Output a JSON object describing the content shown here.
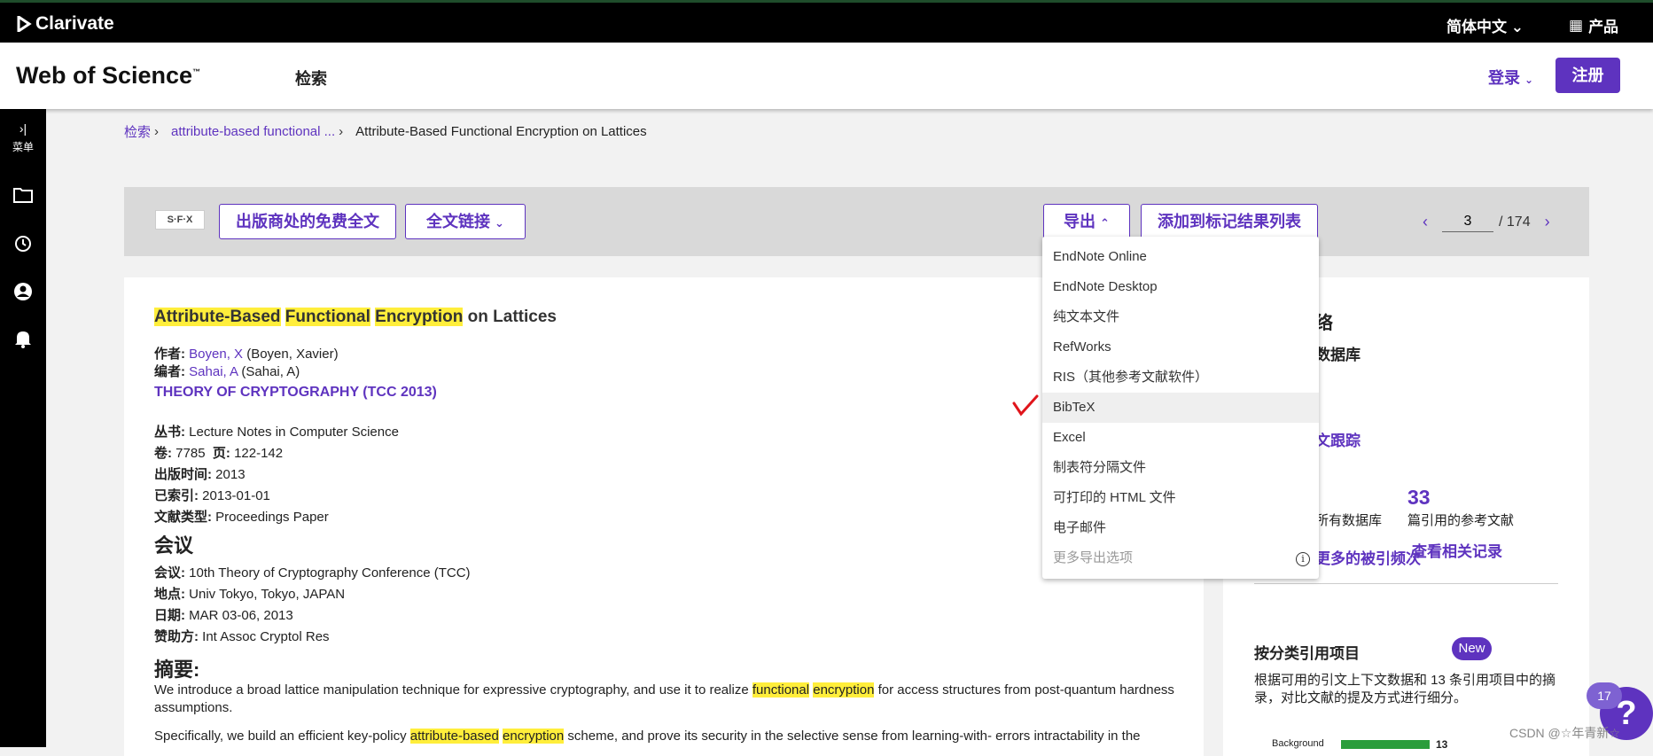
{
  "topbar": {
    "brand": "Clarivate",
    "language": "简体中文",
    "products": "产品"
  },
  "header": {
    "product": "Web of Science",
    "tm": "™",
    "search": "检索",
    "login": "登录",
    "register": "注册"
  },
  "sidebar": {
    "menu_label": "菜单"
  },
  "breadcrumb": {
    "root": "检索",
    "query": "attribute-based functional ...",
    "current": "Attribute-Based Functional Encryption on Lattices"
  },
  "toolbar": {
    "sfx": "S·F·X",
    "free_fulltext": "出版商处的免费全文",
    "fulltext_links": "全文链接",
    "export": "导出",
    "add_to_marked": "添加到标记结果列表",
    "page_current": "3",
    "page_total": "/ 174"
  },
  "export_menu": {
    "options": [
      "EndNote Online",
      "EndNote Desktop",
      "纯文本文件",
      "RefWorks",
      "RIS（其他参考文献软件）",
      "BibTeX",
      "Excel",
      "制表符分隔文件",
      "可打印的 HTML 文件",
      "电子邮件",
      "更多导出选项"
    ],
    "selected": "BibTeX"
  },
  "record": {
    "title_parts": [
      "Attribute-Based",
      "Functional",
      "Encryption",
      "on Lattices"
    ],
    "author_label": "作者:",
    "author_link": "Boyen, X",
    "author_full": "(Boyen, Xavier)",
    "editor_label": "编者:",
    "editor_link": "Sahai, A",
    "editor_full": "(Sahai, A)",
    "source": "THEORY OF CRYPTOGRAPHY (TCC 2013)",
    "series_label": "丛书:",
    "series": "Lecture Notes in Computer Science",
    "volume_label": "卷:",
    "volume": "7785",
    "pages_label": "页:",
    "pages": "122-142",
    "pubdate_label": "出版时间:",
    "pubdate": "2013",
    "indexed_label": "已索引:",
    "indexed": "2013-01-01",
    "doctype_label": "文献类型:",
    "doctype": "Proceedings Paper",
    "conference_heading": "会议",
    "meeting_label": "会议:",
    "meeting": "10th Theory of Cryptography Conference (TCC)",
    "location_label": "地点:",
    "location": "Univ Tokyo, Tokyo, JAPAN",
    "date_label": "日期:",
    "date": "MAR 03-06, 2013",
    "sponsor_label": "赞助方:",
    "sponsor": "Int Assoc Cryptol Res",
    "abstract_heading": "摘要:",
    "abstract_p1_a": "We introduce a broad lattice manipulation technique for expressive cryptography, and use it to realize",
    "abstract_p1_hl1": "functional",
    "abstract_p1_hl2": "encryption",
    "abstract_p1_b": "for access structures from post-quantum hardness assumptions.",
    "abstract_p2_a": "Specifically, we build an efficient key-policy",
    "abstract_p2_hl1": "attribute-based",
    "abstract_p2_hl2": "encryption",
    "abstract_p2_b": "scheme, and prove its security in the selective sense from learning-with- errors intractability in the"
  },
  "right_panel": {
    "h1": "络",
    "db": "数据库",
    "track": "文跟踪",
    "refs_count": "33",
    "all_db": "所有数据库",
    "refs_label": "篇引用的参考文献",
    "more_cites": "更多的被引频次",
    "related": "查看相关记录",
    "classify_title": "按分类引用项目",
    "new_badge": "New",
    "classify_desc": "根据可用的引文上下文数据和 13 条引用项目中的摘录，对比文献的提及方式进行细分。",
    "bar_label": "Background",
    "bar_value": "13"
  },
  "help": {
    "badge": "17",
    "icon": "?"
  },
  "watermark": "CSDN @☆年青新☆"
}
